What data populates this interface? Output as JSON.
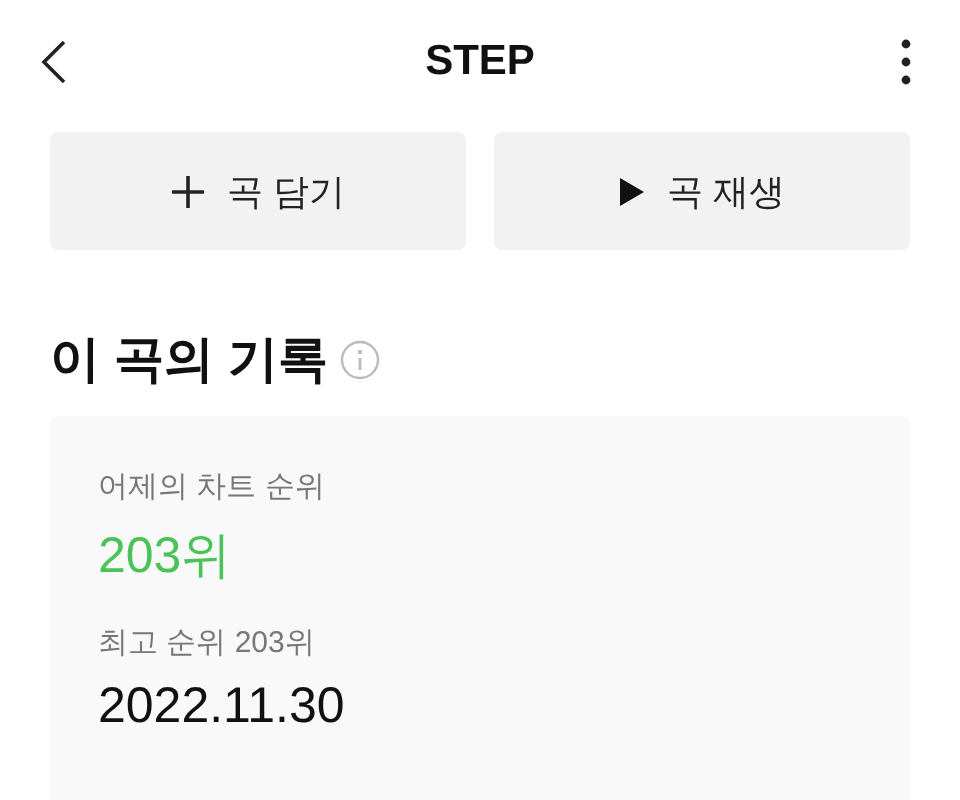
{
  "header": {
    "title": "STEP"
  },
  "buttons": [
    {
      "label": "곡 담기",
      "kind": "add"
    },
    {
      "label": "곡 재생",
      "kind": "play"
    }
  ],
  "section": {
    "title": "이 곡의 기록"
  },
  "stats": [
    {
      "label": "어제의 차트 순위",
      "value": "203위",
      "kind": "highlight"
    },
    {
      "label": "최고 순위 203위",
      "value": "2022.11.30",
      "kind": "plain"
    }
  ]
}
